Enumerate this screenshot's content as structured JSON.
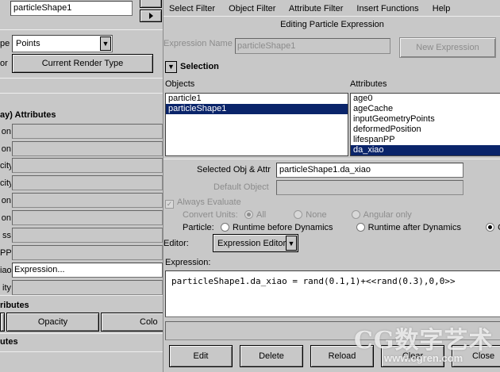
{
  "left": {
    "object_name": "particleShape1",
    "type_label_fragment": "pe",
    "type_value": "Points",
    "color_btn_fragment": "or",
    "current_render_type": "Current Render Type",
    "section_attributes": "ay) Attributes",
    "attr_fragments": [
      "on",
      "on",
      "city",
      "city",
      "on",
      "on",
      "ss",
      "PP",
      "iao",
      "ity"
    ],
    "expression_field": "Expression...",
    "section_attributes2": "ributes",
    "opacity_button": "Opacity",
    "color_button_fragment": "Colo",
    "section_attributes3": "utes"
  },
  "menu": [
    "Select Filter",
    "Object Filter",
    "Attribute Filter",
    "Insert Functions",
    "Help"
  ],
  "title": "Editing Particle Expression",
  "expression_name_label": "Expression Name",
  "expression_name_value": "particleShape1",
  "new_expression": "New Expression",
  "selection_section": "Selection",
  "objects_label": "Objects",
  "attributes_label": "Attributes",
  "objects": [
    {
      "name": "particle1",
      "selected": false
    },
    {
      "name": "particleShape1",
      "selected": true
    }
  ],
  "attributes": [
    {
      "name": "age0",
      "selected": false
    },
    {
      "name": "ageCache",
      "selected": false
    },
    {
      "name": "inputGeometryPoints",
      "selected": false
    },
    {
      "name": "deformedPosition",
      "selected": false
    },
    {
      "name": "lifespanPP",
      "selected": false
    },
    {
      "name": "da_xiao",
      "selected": true
    }
  ],
  "selected_obj_attr_label": "Selected Obj & Attr",
  "selected_obj_attr_value": "particleShape1.da_xiao",
  "default_object_label": "Default Object",
  "default_object_value": "",
  "always_evaluate": "Always Evaluate",
  "convert_units_label": "Convert Units:",
  "convert_units_options": [
    "All",
    "None",
    "Angular only"
  ],
  "convert_units_selected": "All",
  "particle_label": "Particle:",
  "particle_options": [
    "Runtime before Dynamics",
    "Runtime after Dynamics",
    "Cr"
  ],
  "particle_selected": "Cr",
  "editor_label": "Editor:",
  "editor_value": "Expression Editor",
  "expression_label": "Expression:",
  "expression_text": "particleShape1.da_xiao = rand(0.1,1)+<<rand(0.3),0,0>>",
  "buttons": [
    "Edit",
    "Delete",
    "Reload",
    "Clear",
    "Close"
  ],
  "watermark_top": "CG数字艺术",
  "watermark_bottom": "www.cgren.com"
}
